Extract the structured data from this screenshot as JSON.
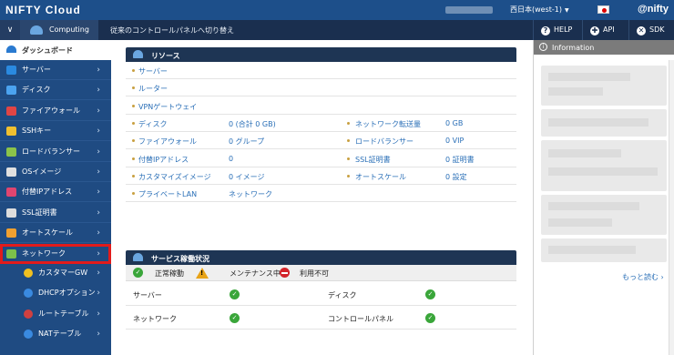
{
  "header": {
    "logo": "NIFTY Cloud",
    "region": "西日本(west-1)",
    "brand": "@nifty"
  },
  "subheader": {
    "menu_icon": "chevron-down-icon",
    "computing": "Computing",
    "switch_link": "従来のコントロールパネルへ切り替え",
    "help": "HELP",
    "api": "API",
    "sdk": "SDK"
  },
  "sidebar": {
    "dashboard": "ダッシュボード",
    "items": [
      {
        "label": "サーバー",
        "icon": "server-icon",
        "color": "#2a8ae0"
      },
      {
        "label": "ディスク",
        "icon": "disk-icon",
        "color": "#4ba3f0"
      },
      {
        "label": "ファイアウォール",
        "icon": "firewall-icon",
        "color": "#e04545"
      },
      {
        "label": "SSHキー",
        "icon": "key-icon",
        "color": "#f0c030"
      },
      {
        "label": "ロードバランサー",
        "icon": "load-balancer-icon",
        "color": "#8bc34a"
      },
      {
        "label": "OSイメージ",
        "icon": "os-image-icon",
        "color": "#e0e0e0"
      },
      {
        "label": "付替IPアドレス",
        "icon": "ip-address-icon",
        "color": "#e04570"
      },
      {
        "label": "SSL証明書",
        "icon": "ssl-certificate-icon",
        "color": "#ddd"
      },
      {
        "label": "オートスケール",
        "icon": "autoscale-icon",
        "color": "#f0a030"
      },
      {
        "label": "ネットワーク",
        "icon": "network-icon",
        "color": "#7cc04a"
      }
    ],
    "subitems": [
      {
        "label": "カスタマーGW",
        "icon": "customer-gateway-icon",
        "color": "#f0c020"
      },
      {
        "label": "DHCPオプション",
        "icon": "dhcp-icon",
        "color": "#3a8ae0"
      },
      {
        "label": "ルートテーブル",
        "icon": "route-table-icon",
        "color": "#d04040"
      },
      {
        "label": "NATテーブル",
        "icon": "nat-table-icon",
        "color": "#3a8ae0"
      }
    ]
  },
  "resources": {
    "title": "リソース",
    "single_rows": [
      "サーバー",
      "ルーター",
      "VPNゲートウェイ"
    ],
    "rows": [
      {
        "left_label": "ディスク",
        "left_value": "0 (合計 0 GB)",
        "right_label": "ネットワーク転送量",
        "right_value": "0 GB"
      },
      {
        "left_label": "ファイアウォール",
        "left_value": "0 グループ",
        "right_label": "ロードバランサー",
        "right_value": "0 VIP"
      },
      {
        "left_label": "付替IPアドレス",
        "left_value": "0",
        "right_label": "SSL証明書",
        "right_value": "0 証明書"
      },
      {
        "left_label": "カスタマイズイメージ",
        "left_value": "0 イメージ",
        "right_label": "オートスケール",
        "right_value": "0 設定"
      },
      {
        "left_label": "プライベートLAN",
        "left_value": "ネットワーク",
        "right_label": "",
        "right_value": ""
      }
    ]
  },
  "service_status": {
    "title": "サービス稼働状況",
    "legend": {
      "ok": "正常稼動",
      "maintenance": "メンテナンス中",
      "unavailable": "利用不可"
    },
    "rows": [
      {
        "left": "サーバー",
        "right": "ディスク"
      },
      {
        "left": "ネットワーク",
        "right": "コントロールパネル"
      }
    ]
  },
  "info": {
    "title": "Information",
    "more": "もっと読む"
  }
}
